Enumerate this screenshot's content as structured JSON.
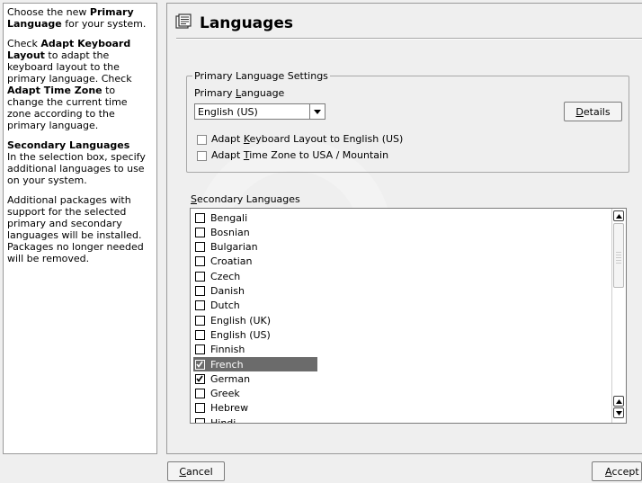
{
  "help": {
    "p1_a": "Choose the new ",
    "p1_b": "Primary Language",
    "p1_c": " for your system.",
    "p2_a": "Check ",
    "p2_b": "Adapt Keyboard Layout",
    "p2_c": " to adapt the keyboard layout to the primary language. Check ",
    "p2_d": "Adapt Time Zone",
    "p2_e": " to change the current time zone according to the primary language.",
    "p3_title": "Secondary Languages",
    "p3_body": "In the selection box, specify additional languages to use on your system.",
    "p4": "Additional packages with support for the selected primary and secondary languages will be installed. Packages no longer needed will be removed."
  },
  "header": {
    "title": "Languages",
    "icon": "languages-icon"
  },
  "primary_group": {
    "legend": "Primary Language Settings",
    "label_pre": "Primary ",
    "label_mnemonic": "L",
    "label_post": "anguage",
    "value": "English (US)",
    "details_mnemonic": "D",
    "details_rest": "etails",
    "keyboard_pre": "Adapt ",
    "keyboard_mnemonic": "K",
    "keyboard_post": "eyboard Layout to English (US)",
    "keyboard_checked": false,
    "timezone_pre": "Adapt ",
    "timezone_mnemonic": "T",
    "timezone_post": "ime Zone to USA / Mountain",
    "timezone_checked": false
  },
  "secondary": {
    "label_mnemonic": "S",
    "label_rest": "econdary Languages",
    "items": [
      {
        "label": "Bengali",
        "checked": false,
        "selected": false
      },
      {
        "label": "Bosnian",
        "checked": false,
        "selected": false
      },
      {
        "label": "Bulgarian",
        "checked": false,
        "selected": false
      },
      {
        "label": "Croatian",
        "checked": false,
        "selected": false
      },
      {
        "label": "Czech",
        "checked": false,
        "selected": false
      },
      {
        "label": "Danish",
        "checked": false,
        "selected": false
      },
      {
        "label": "Dutch",
        "checked": false,
        "selected": false
      },
      {
        "label": "English (UK)",
        "checked": false,
        "selected": false
      },
      {
        "label": "English (US)",
        "checked": false,
        "selected": false
      },
      {
        "label": "Finnish",
        "checked": false,
        "selected": false
      },
      {
        "label": "French",
        "checked": true,
        "selected": true
      },
      {
        "label": "German",
        "checked": true,
        "selected": false
      },
      {
        "label": "Greek",
        "checked": false,
        "selected": false
      },
      {
        "label": "Hebrew",
        "checked": false,
        "selected": false
      },
      {
        "label": "Hindi",
        "checked": false,
        "selected": false
      }
    ]
  },
  "footer": {
    "cancel_mnemonic": "C",
    "cancel_rest": "ancel",
    "accept_mnemonic": "A",
    "accept_rest": "ccept"
  }
}
